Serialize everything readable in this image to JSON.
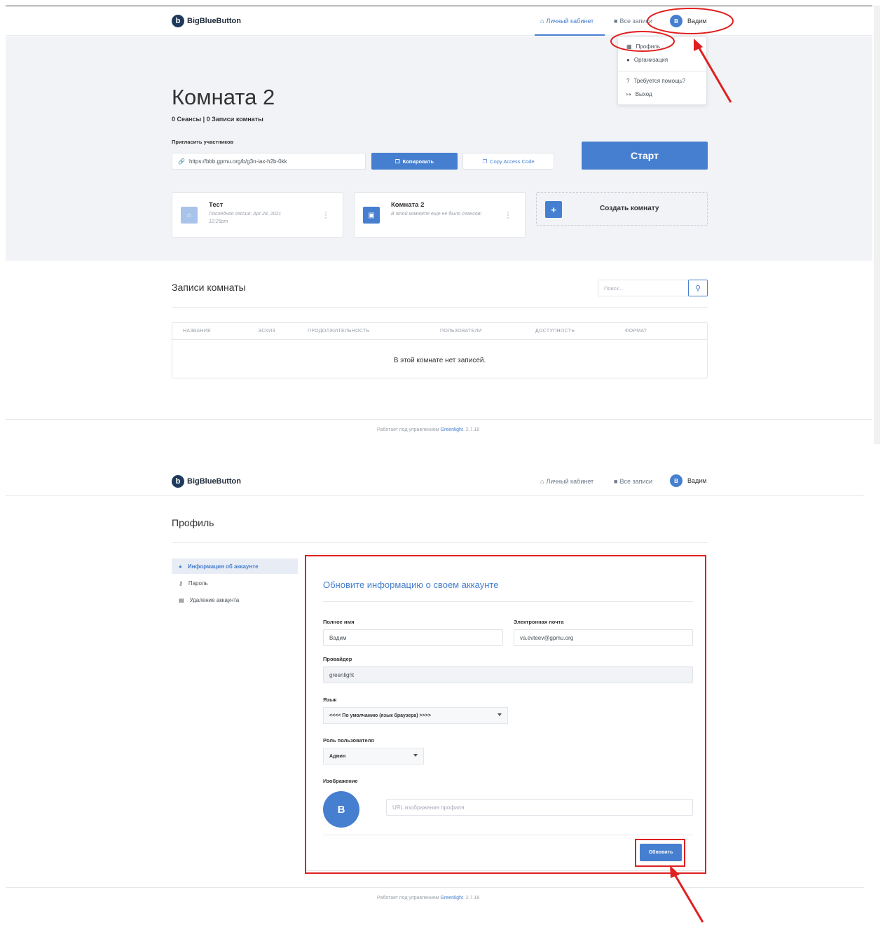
{
  "brand": {
    "name": "BigBlueButton",
    "mark": "b"
  },
  "accent_color": "#467fcf",
  "annotation_color": "#e02020",
  "top": {
    "nav": {
      "home": "Личный кабинет",
      "recordings": "Все записи",
      "user": "Вадим",
      "user_initial": "В"
    },
    "dropdown": {
      "profile": "Профиль",
      "organization": "Организация",
      "help": "Требуется помощь?",
      "logout": "Выход"
    },
    "room": {
      "title": "Комната 2",
      "stats": "0 Сеансы | 0 Записи комнаты",
      "invite_label": "Пригласить участников",
      "invite_url": "https://bbb.gpmu.org/b/g3n-iax-h2b-0kk",
      "copy_button": "Копировать",
      "access_button": "Copy Access Code",
      "start_button": "Старт"
    },
    "cards": [
      {
        "name": "Тест",
        "subtitle": "Последняя сессия: Apr 28, 2021 12:25pm",
        "icon": "home-icon"
      },
      {
        "name": "Комната 2",
        "subtitle": "В этой комнате еще не было сеансов!",
        "icon": "chalkboard-icon"
      }
    ],
    "create_room": "Создать комнату",
    "recordings": {
      "title": "Записи комнаты",
      "search_placeholder": "Поиск...",
      "columns": [
        "НАЗВАНИЕ",
        "ЭСКИЗ",
        "ПРОДОЛЖИТЕЛЬНОСТЬ",
        "ПОЛЬЗОВАТЕЛИ",
        "ДОСТУПНОСТЬ",
        "ФОРМАТ"
      ],
      "empty": "В этой комнате нет записей."
    },
    "footer": {
      "prefix": "Работает под управлением ",
      "link": "Greenlight",
      "suffix": ". 2.7.18"
    }
  },
  "bottom": {
    "nav": {
      "home": "Личный кабинет",
      "recordings": "Все записи",
      "user": "Вадим",
      "user_initial": "В"
    },
    "page_title": "Профиль",
    "sidebar": [
      {
        "label": "Информация об аккаунте",
        "icon": "user-icon",
        "active": true
      },
      {
        "label": "Пароль",
        "icon": "key-icon",
        "active": false
      },
      {
        "label": "Удаление аккаунта",
        "icon": "trash-icon",
        "active": false
      }
    ],
    "form": {
      "heading": "Обновите информацию о своем аккаунте",
      "name_label": "Полное имя",
      "name_value": "Вадим",
      "email_label": "Электронная почта",
      "email_value": "va.evteev@gpmu.org",
      "provider_label": "Провайдер",
      "provider_value": "greenlight",
      "language_label": "Язык",
      "language_value": "<<<< По умолчанию (язык браузера) >>>>",
      "role_label": "Роль пользователя",
      "role_value": "Админ",
      "image_label": "Изображение",
      "avatar_initial": "В",
      "image_url_placeholder": "URL изображения профиля",
      "update_button": "Обновить"
    },
    "footer": {
      "prefix": "Работает под управлением ",
      "link": "Greenlight",
      "suffix": ". 2.7.18"
    }
  }
}
